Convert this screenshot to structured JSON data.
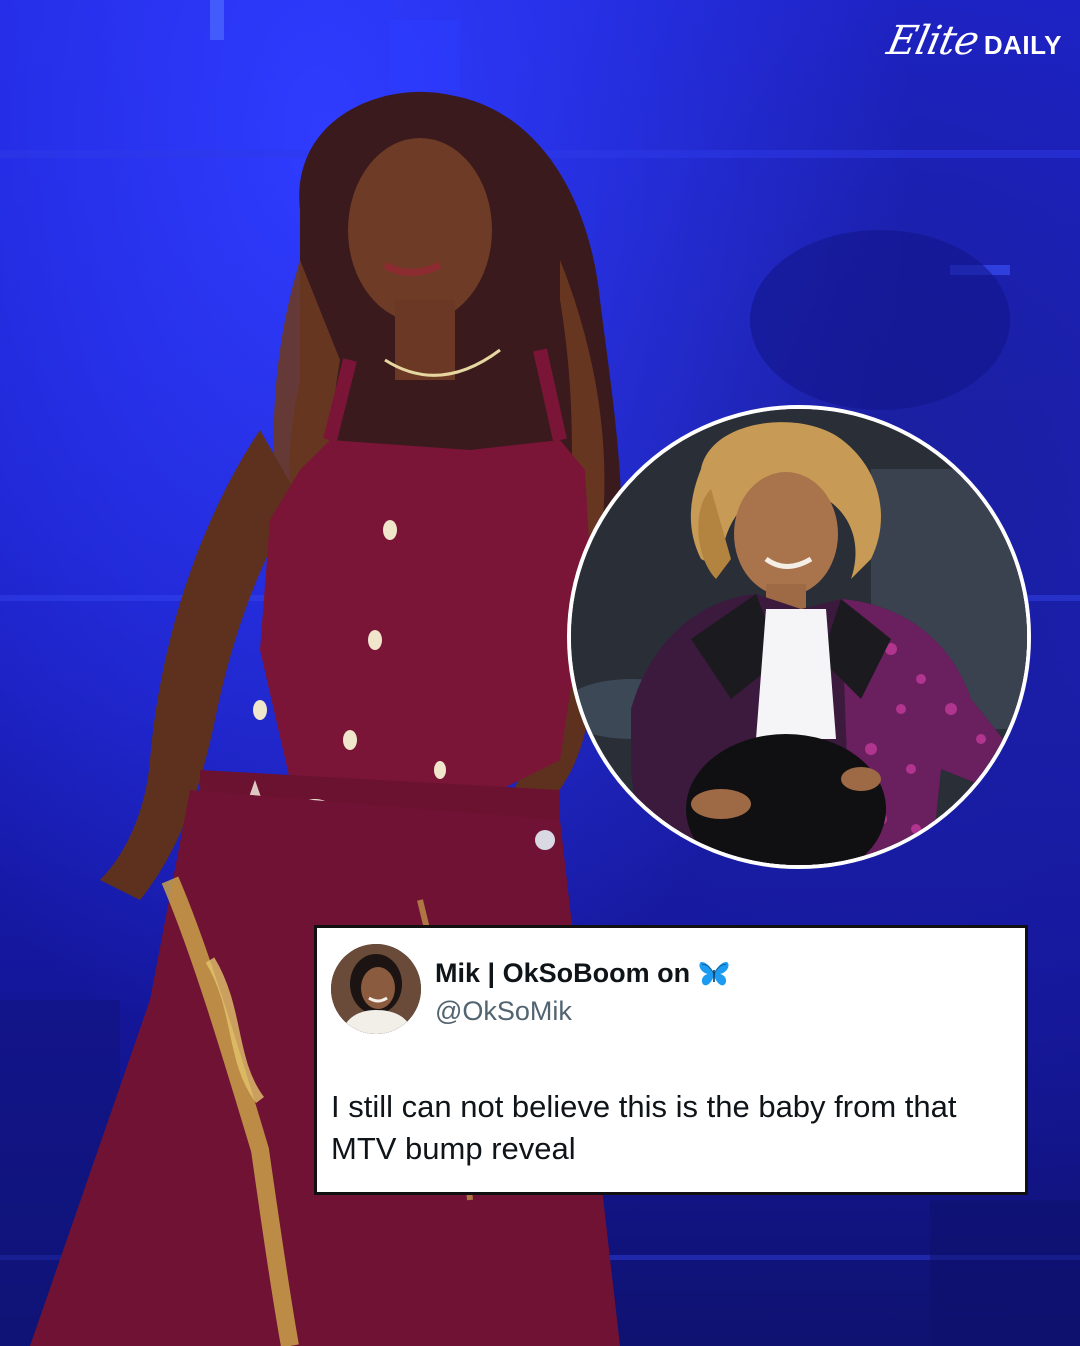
{
  "brand": {
    "logo_script": "Elite",
    "logo_bold": "DAILY"
  },
  "tweet": {
    "display_name": "Mik | OkSoBoom on",
    "name_emoji_icon": "butterfly-icon",
    "handle": "@OkSoMik",
    "text": "I still can not believe this is the baby from that MTV bump reveal"
  },
  "colors": {
    "background_blue": "#1a22c8",
    "outfit_burgundy": "#7a1538",
    "tweet_text": "#0f1419",
    "tweet_handle": "#536471",
    "butterfly_blue": "#1d9bf0"
  }
}
